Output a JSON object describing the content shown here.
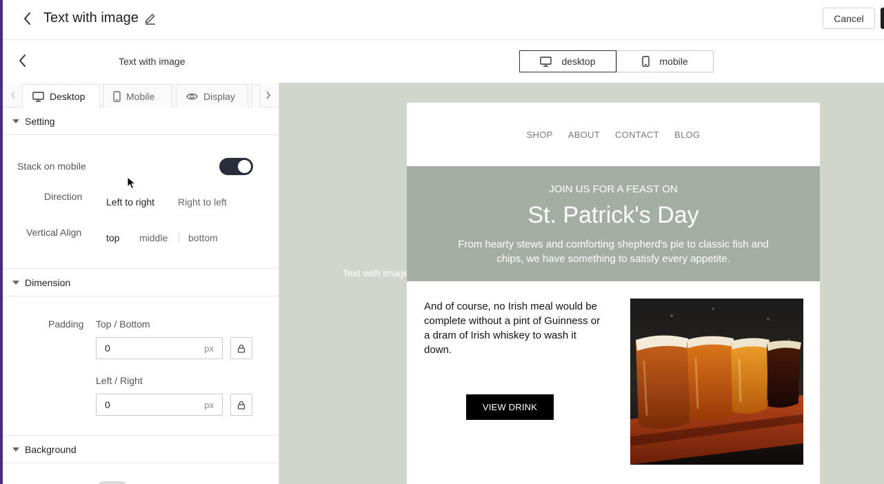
{
  "header": {
    "title": "Text with image",
    "cancel_label": "Cancel"
  },
  "subbar": {
    "title": "Text with image",
    "devices": [
      {
        "label": "desktop",
        "icon": "monitor-icon",
        "active": true
      },
      {
        "label": "mobile",
        "icon": "phone-icon",
        "active": false
      }
    ]
  },
  "tabs": [
    {
      "label": "Desktop",
      "icon": "monitor-icon",
      "active": true
    },
    {
      "label": "Mobile",
      "icon": "phone-icon",
      "active": false
    },
    {
      "label": "Display",
      "icon": "eye-icon",
      "active": false
    }
  ],
  "setting": {
    "section_title": "Setting",
    "stack_label": "Stack on mobile",
    "stack_on": true,
    "direction_label": "Direction",
    "direction_options": [
      "Left to right",
      "Right to left"
    ],
    "direction_selected": "Left to right",
    "valign_label": "Vertical Align",
    "valign_options": [
      "top",
      "middle",
      "bottom"
    ],
    "valign_selected": "top"
  },
  "dimension": {
    "section_title": "Dimension",
    "padding_label": "Padding",
    "top_bottom_label": "Top / Bottom",
    "top_bottom_value": "0",
    "left_right_label": "Left / Right",
    "left_right_value": "0",
    "unit": "px"
  },
  "background": {
    "section_title": "Background"
  },
  "preview": {
    "block_label": "Text with image",
    "nav": [
      "SHOP",
      "ABOUT",
      "CONTACT",
      "BLOG"
    ],
    "hero_eyebrow": "JOIN US FOR A FEAST ON",
    "hero_title": "St. Patrick's Day",
    "hero_desc": "From hearty stews and comforting shepherd's pie to classic fish and chips, we have something to satisfy every appetite.",
    "body_text": "And of course, no Irish meal would be complete without a pint of Guinness or a dram of Irish whiskey to wash it down.",
    "cta_label": "VIEW DRINK",
    "image_icon": "beer-flight-image"
  },
  "colors": {
    "accent": "#4b2d7f",
    "toggle": "#2a2d3a",
    "preview_bg": "#d1d6cc",
    "hero_bg": "#a5aea3"
  }
}
